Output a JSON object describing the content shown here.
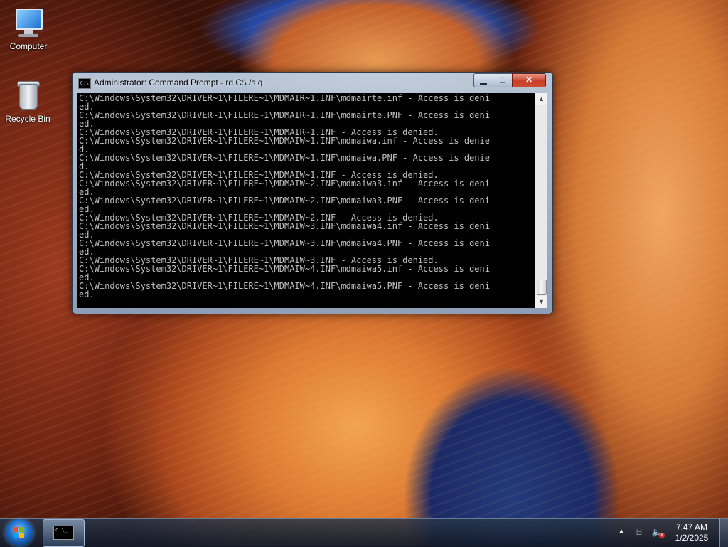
{
  "desktop": {
    "icons": [
      {
        "label": "Computer"
      },
      {
        "label": "Recycle Bin"
      }
    ]
  },
  "window": {
    "title": "Administrator:  Command Prompt - rd  C:\\ /s q",
    "icon_text": "C:\\",
    "controls": {
      "minimize": "▁",
      "maximize": "□",
      "close": "✕"
    },
    "console_lines": [
      "C:\\Windows\\System32\\DRIVER~1\\FILERE~1\\MDMAIR~1.INF\\mdmairte.inf - Access is deni",
      "ed.",
      "C:\\Windows\\System32\\DRIVER~1\\FILERE~1\\MDMAIR~1.INF\\mdmairte.PNF - Access is deni",
      "ed.",
      "C:\\Windows\\System32\\DRIVER~1\\FILERE~1\\MDMAIR~1.INF - Access is denied.",
      "C:\\Windows\\System32\\DRIVER~1\\FILERE~1\\MDMAIW~1.INF\\mdmaiwa.inf - Access is denie",
      "d.",
      "C:\\Windows\\System32\\DRIVER~1\\FILERE~1\\MDMAIW~1.INF\\mdmaiwa.PNF - Access is denie",
      "d.",
      "C:\\Windows\\System32\\DRIVER~1\\FILERE~1\\MDMAIW~1.INF - Access is denied.",
      "C:\\Windows\\System32\\DRIVER~1\\FILERE~1\\MDMAIW~2.INF\\mdmaiwa3.inf - Access is deni",
      "ed.",
      "C:\\Windows\\System32\\DRIVER~1\\FILERE~1\\MDMAIW~2.INF\\mdmaiwa3.PNF - Access is deni",
      "ed.",
      "C:\\Windows\\System32\\DRIVER~1\\FILERE~1\\MDMAIW~2.INF - Access is denied.",
      "C:\\Windows\\System32\\DRIVER~1\\FILERE~1\\MDMAIW~3.INF\\mdmaiwa4.inf - Access is deni",
      "ed.",
      "C:\\Windows\\System32\\DRIVER~1\\FILERE~1\\MDMAIW~3.INF\\mdmaiwa4.PNF - Access is deni",
      "ed.",
      "C:\\Windows\\System32\\DRIVER~1\\FILERE~1\\MDMAIW~3.INF - Access is denied.",
      "C:\\Windows\\System32\\DRIVER~1\\FILERE~1\\MDMAIW~4.INF\\mdmaiwa5.inf - Access is deni",
      "ed.",
      "C:\\Windows\\System32\\DRIVER~1\\FILERE~1\\MDMAIW~4.INF\\mdmaiwa5.PNF - Access is deni",
      "ed."
    ]
  },
  "taskbar": {
    "task_icon_text": "C:\\_",
    "tray": {
      "arrow": "▲",
      "network_icon": "network-icon",
      "volume_icon": "volume-muted-icon"
    },
    "clock": {
      "time": "7:47 AM",
      "date": "1/2/2025"
    }
  },
  "colors": {
    "console_bg": "#000000",
    "console_fg": "#c0c0c0",
    "close_button": "#c7402b"
  }
}
